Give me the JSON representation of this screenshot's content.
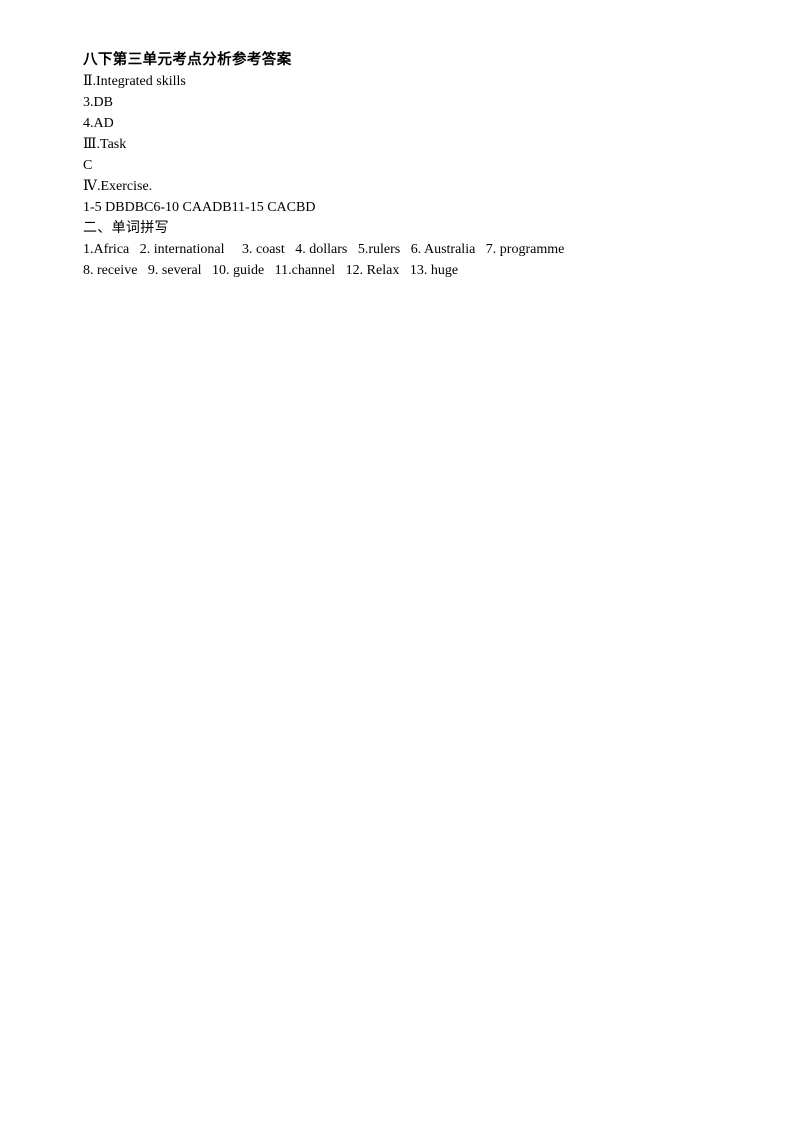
{
  "document": {
    "title": "八下第三单元考点分析参考答案",
    "page_background": "#ffffff",
    "text_color": "#000000",
    "sections": {
      "integrated_skills": {
        "heading": "Ⅱ.Integrated skills",
        "answers": [
          "3.DB",
          "4.AD"
        ]
      },
      "task": {
        "heading": "Ⅲ.Task",
        "answers": [
          "C"
        ]
      },
      "exercise": {
        "heading": "Ⅳ.Exercise.",
        "answers": [
          "1-5 DBDBC6-10 CAADB11-15 CACBD"
        ]
      },
      "word_spelling": {
        "heading": "二、单词拼写",
        "lines": [
          "1.Africa   2. international     3. coast   4. dollars   5.rulers   6. Australia   7. programme",
          "8. receive   9. several   10. guide   11.channel   12. Relax   13. huge"
        ],
        "items": [
          {
            "number": "1.",
            "word": "Africa"
          },
          {
            "number": "2.",
            "word": "international"
          },
          {
            "number": "3.",
            "word": "coast"
          },
          {
            "number": "4.",
            "word": "dollars"
          },
          {
            "number": "5.",
            "word": "rulers"
          },
          {
            "number": "6.",
            "word": "Australia"
          },
          {
            "number": "7.",
            "word": "programme"
          },
          {
            "number": "8.",
            "word": "receive"
          },
          {
            "number": "9.",
            "word": "several"
          },
          {
            "number": "10.",
            "word": "guide"
          },
          {
            "number": "11.",
            "word": "channel"
          },
          {
            "number": "12.",
            "word": "Relax"
          },
          {
            "number": "13.",
            "word": "huge"
          }
        ]
      }
    }
  }
}
